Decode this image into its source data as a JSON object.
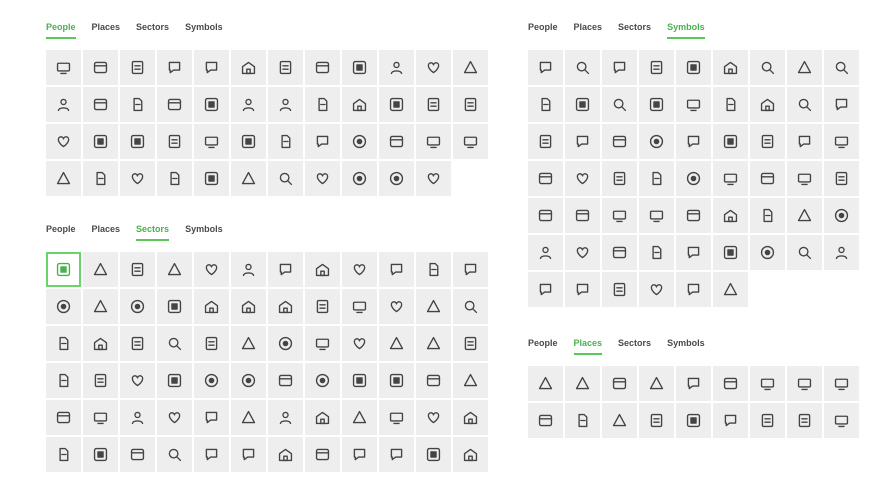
{
  "accent_color": "#5cc65c",
  "panels": [
    {
      "id": "people",
      "tabs": [
        "People",
        "Places",
        "Sectors",
        "Symbols"
      ],
      "active": 0,
      "cols": 12,
      "selected": -1,
      "icons": [
        "building",
        "bus",
        "clipboard",
        "calendar",
        "heart-hand",
        "clipboard-user",
        "person-stand",
        "rocket",
        "people-group",
        "person-group",
        "news",
        "receipt",
        "person-id",
        "person-chat",
        "person-gear",
        "person-card",
        "person-add",
        "person-lock",
        "person-up",
        "handshake",
        "monitor",
        "contact-card",
        "id-card",
        "monitor-user",
        "monitor-chart",
        "gamepad",
        "id-badge",
        "screen-share",
        "image-edit",
        "award",
        "person-gear",
        "headset",
        "video-user",
        "doc-user",
        "chat-user",
        "doc-lock",
        "hand-heart",
        "group",
        "crown",
        "hand-coin",
        "target",
        "smile",
        "face",
        "face-neutral",
        "pill",
        "pill",
        "gear"
      ]
    },
    {
      "id": "sectors",
      "tabs": [
        "People",
        "Places",
        "Sectors",
        "Symbols"
      ],
      "active": 2,
      "cols": 12,
      "selected": 0,
      "icons": [
        "globe",
        "search-gear",
        "search-person",
        "bank",
        "video",
        "server",
        "cup",
        "beaker",
        "database",
        "calendar",
        "lock",
        "phone",
        "scroll",
        "receipt",
        "bulb",
        "smartphone",
        "monitor",
        "chat-bubbles",
        "monitor",
        "network",
        "chat",
        "person-run",
        "heart-box",
        "shield",
        "box",
        "glasses",
        "microphone",
        "stethoscope",
        "bandage",
        "chart-box",
        "pulse",
        "dashboard",
        "flower",
        "car",
        "bag",
        "person-chef",
        "lab-flask",
        "brush",
        "dome",
        "shopping-cart",
        "wallet",
        "clipboard-check",
        "crab",
        "play-film",
        "newspaper",
        "gamepad",
        "triangle",
        "joystick",
        "bus",
        "train",
        "paper-stack",
        "sun-doc",
        "tram",
        "bag",
        "tools",
        "trash-calc",
        "coffee",
        "toaster",
        "badge",
        "folder",
        "chat-leaf",
        "music",
        "cabinet",
        "chair",
        "bowl",
        "basket",
        "monitor",
        "trophy",
        "chart-up",
        "guitar",
        "target",
        "leaf"
      ]
    },
    {
      "id": "symbols",
      "tabs": [
        "People",
        "Places",
        "Sectors",
        "Symbols"
      ],
      "active": 3,
      "cols": 9,
      "selected": -1,
      "icons": [
        "tag",
        "spiral",
        "tag",
        "bookmark",
        "copy",
        "folder",
        "folder-open",
        "smile",
        "moon",
        "mail",
        "globe",
        "arrows-h",
        "pen",
        "hand-down",
        "home",
        "list",
        "pie-chart",
        "chart-up",
        "clock",
        "link",
        "sun",
        "pill",
        "link",
        "copy",
        "clipboard",
        "star",
        "magic-wand",
        "diamond",
        "x-swords",
        "fire",
        "home",
        "bulb",
        "umbrella",
        "search",
        "flag",
        "chat-box",
        "trophy",
        "ring",
        "chat",
        "chat",
        "quote",
        "hash",
        "box",
        "doc",
        "frame",
        "phone-waves",
        "gem",
        "toggle",
        "drop",
        "heart",
        "target",
        "frame",
        "square",
        "triangle-down",
        "calendar",
        "calendar",
        "clock",
        "badge",
        "cup",
        "filter"
      ]
    },
    {
      "id": "places",
      "tabs": [
        "People",
        "Places",
        "Sectors",
        "Symbols"
      ],
      "active": 1,
      "cols": 9,
      "selected": -1,
      "icons": [
        "doc",
        "doc",
        "house-user",
        "bank",
        "factory",
        "stack",
        "chart-bar",
        "building",
        "building",
        "triangle",
        "tent",
        "map-pin",
        "clock",
        "globe",
        "arrows",
        "grid",
        "grid",
        "flag"
      ]
    }
  ]
}
